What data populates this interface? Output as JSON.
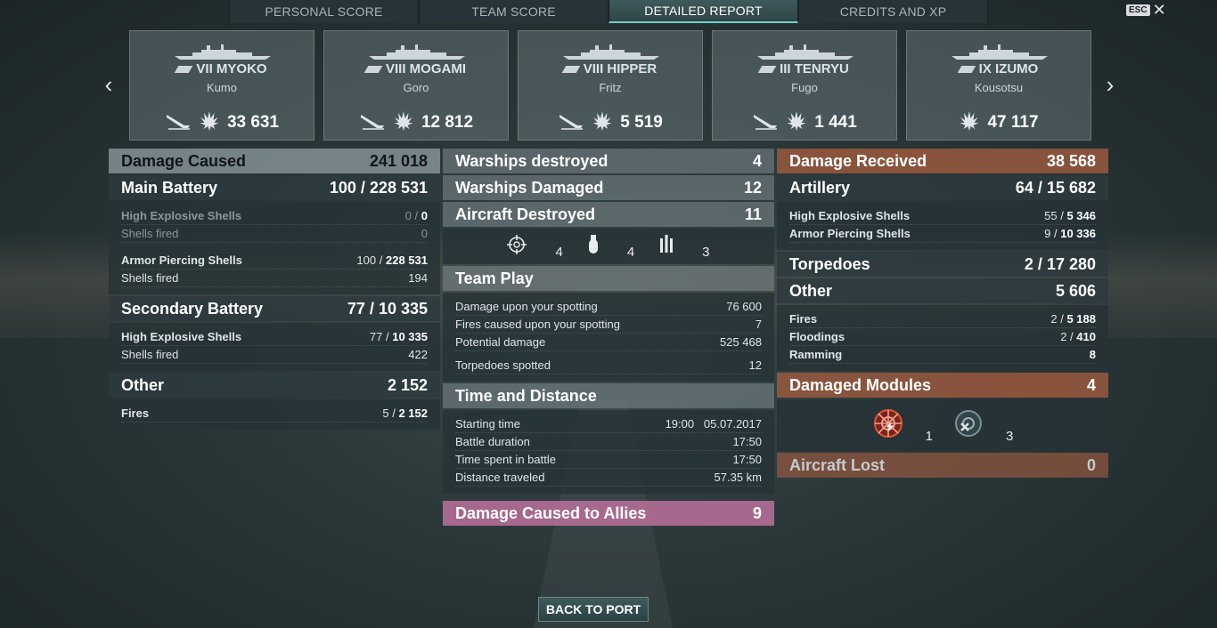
{
  "tabs": [
    {
      "label": "PERSONAL SCORE"
    },
    {
      "label": "TEAM SCORE"
    },
    {
      "label": "DETAILED REPORT"
    },
    {
      "label": "CREDITS AND XP"
    }
  ],
  "esc": {
    "key": "ESC",
    "close": "✕"
  },
  "nav": {
    "left": "‹",
    "right": "›"
  },
  "ships": [
    {
      "name": "VII MYOKO",
      "player": "Kumo",
      "damage": "33 631",
      "sunk": true
    },
    {
      "name": "VIII MOGAMI",
      "player": "Goro",
      "damage": "12 812",
      "sunk": true
    },
    {
      "name": "VIII HIPPER",
      "player": "Fritz",
      "damage": "5 519",
      "sunk": true
    },
    {
      "name": "III TENRYU",
      "player": "Fugo",
      "damage": "1 441",
      "sunk": true
    },
    {
      "name": "IX IZUMO",
      "player": "Kousotsu",
      "damage": "47 117",
      "sunk": false
    }
  ],
  "left": {
    "damage_caused": {
      "label": "Damage Caused",
      "value": "241 018"
    },
    "main_battery": {
      "label": "Main Battery",
      "hits": "100",
      "sep": "/",
      "value": "228 531"
    },
    "mb_he": {
      "label": "High Explosive Shells",
      "hits": "0",
      "sep": "/",
      "value": "0"
    },
    "mb_he_fired": {
      "label": "Shells fired",
      "value": "0"
    },
    "mb_ap": {
      "label": "Armor Piercing Shells",
      "hits": "100",
      "sep": "/",
      "value": "228 531"
    },
    "mb_ap_fired": {
      "label": "Shells fired",
      "value": "194"
    },
    "secondary": {
      "label": "Secondary Battery",
      "hits": "77",
      "sep": "/",
      "value": "10 335"
    },
    "sb_he": {
      "label": "High Explosive Shells",
      "hits": "77",
      "sep": "/",
      "value": "10 335"
    },
    "sb_fired": {
      "label": "Shells fired",
      "value": "422"
    },
    "other": {
      "label": "Other",
      "value": "2 152"
    },
    "fires": {
      "label": "Fires",
      "hits": "5",
      "sep": "/",
      "value": "2 152"
    }
  },
  "mid": {
    "warships_destroyed": {
      "label": "Warships destroyed",
      "value": "4"
    },
    "warships_damaged": {
      "label": "Warships Damaged",
      "value": "12"
    },
    "aircraft_destroyed": {
      "label": "Aircraft Destroyed",
      "value": "11"
    },
    "icons": [
      {
        "icon": "crosshair-icon",
        "value": "4"
      },
      {
        "icon": "bomb-icon",
        "value": "4"
      },
      {
        "icon": "rockets-icon",
        "value": "3"
      }
    ],
    "team_play": {
      "label": "Team Play"
    },
    "tp_rows": [
      {
        "label": "Damage upon your spotting",
        "value": "76 600"
      },
      {
        "label": "Fires caused upon your spotting",
        "value": "7"
      },
      {
        "label": "Potential damage",
        "value": "525 468"
      },
      {
        "label": "Torpedoes spotted",
        "value": "12"
      }
    ],
    "time_distance": {
      "label": "Time and Distance"
    },
    "td_rows": [
      {
        "label": "Starting time",
        "value": "19:00   05.07.2017"
      },
      {
        "label": "Battle duration",
        "value": "17:50"
      },
      {
        "label": "Time spent in battle",
        "value": "17:50"
      },
      {
        "label": "Distance traveled",
        "value": "57.35 km"
      }
    ],
    "allies": {
      "label": "Damage Caused to Allies",
      "value": "9"
    }
  },
  "right": {
    "damage_received": {
      "label": "Damage Received",
      "value": "38 568"
    },
    "artillery": {
      "label": "Artillery",
      "hits": "64",
      "sep": "/",
      "value": "15 682"
    },
    "art_he": {
      "label": "High Explosive Shells",
      "hits": "55",
      "sep": "/",
      "value": "5 346"
    },
    "art_ap": {
      "label": "Armor Piercing Shells",
      "hits": "9",
      "sep": "/",
      "value": "10 336"
    },
    "torpedoes": {
      "label": "Torpedoes",
      "hits": "2",
      "sep": "/",
      "value": "17 280"
    },
    "other": {
      "label": "Other",
      "value": "5 606"
    },
    "fires": {
      "label": "Fires",
      "hits": "2",
      "sep": "/",
      "value": "5 188"
    },
    "floodings": {
      "label": "Floodings",
      "hits": "2",
      "sep": "/",
      "value": "410"
    },
    "ramming": {
      "label": "Ramming",
      "value": "8"
    },
    "modules": {
      "label": "Damaged Modules",
      "value": "4"
    },
    "module_icons": [
      {
        "icon": "steering-gear-damaged-icon",
        "value": "1"
      },
      {
        "icon": "engine-destroyed-icon",
        "value": "3"
      }
    ],
    "aircraft_lost": {
      "label": "Aircraft Lost",
      "value": "0"
    }
  },
  "back_button": "BACK TO PORT",
  "colors": {
    "accent": "#6fd0c8",
    "received": "#96583e",
    "allies": "#b46e96"
  }
}
